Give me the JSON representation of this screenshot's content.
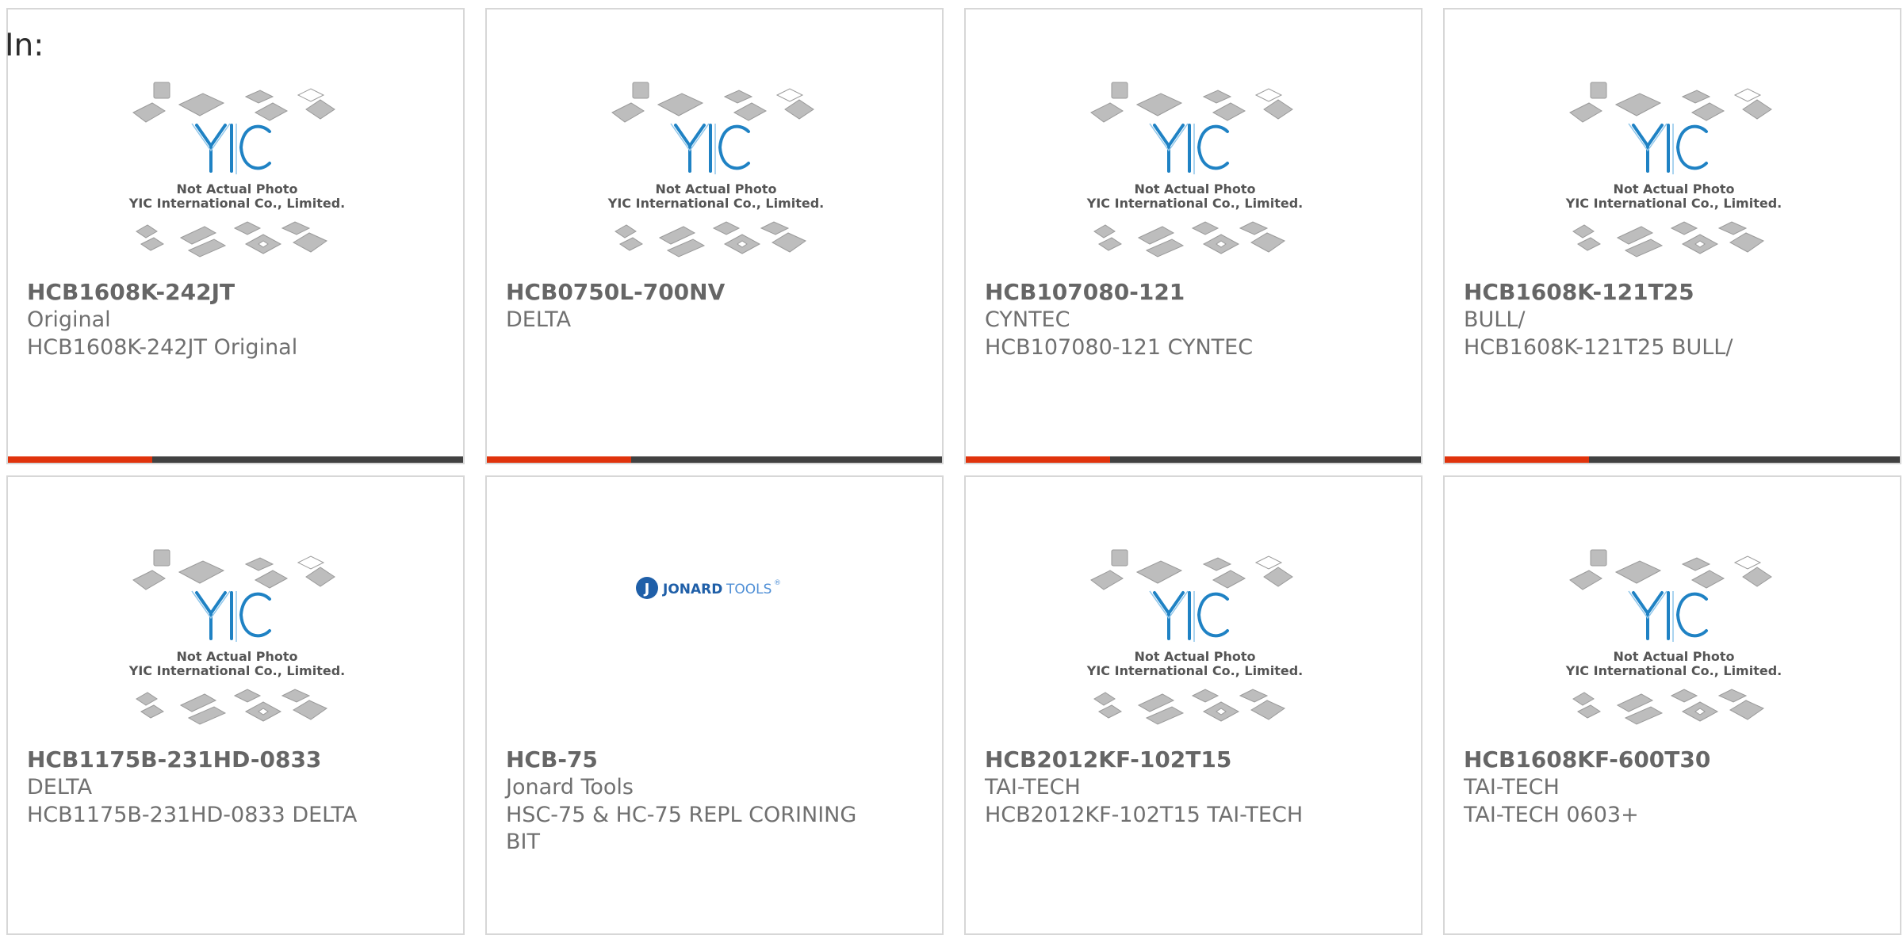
{
  "page_label": "In:",
  "colors": {
    "accent": "#e0330c",
    "bar_dark": "#414141",
    "logo_blue": "#1f82c4"
  },
  "placeholder": {
    "line1": "Not Actual Photo",
    "line2": "YIC International Co., Limited."
  },
  "jonard_logo": {
    "left": "JONARD",
    "right": "TOOLS",
    "mark": "J",
    "reg": "®"
  },
  "products": [
    {
      "part_number": "HCB1608K-242JT",
      "manufacturer": "Original",
      "description": "HCB1608K-242JT Original",
      "image": "yic-placeholder"
    },
    {
      "part_number": "HCB0750L-700NV",
      "manufacturer": "DELTA",
      "description": "",
      "image": "yic-placeholder"
    },
    {
      "part_number": "HCB107080-121",
      "manufacturer": "CYNTEC",
      "description": "HCB107080-121 CYNTEC",
      "image": "yic-placeholder"
    },
    {
      "part_number": "HCB1608K-121T25",
      "manufacturer": "BULL/",
      "description": "HCB1608K-121T25 BULL/",
      "image": "yic-placeholder"
    },
    {
      "part_number": "HCB1175B-231HD-0833",
      "manufacturer": "DELTA",
      "description": "HCB1175B-231HD-0833 DELTA",
      "image": "yic-placeholder"
    },
    {
      "part_number": "HCB-75",
      "manufacturer": "Jonard Tools",
      "description": "HSC-75 & HC-75 REPL CORINING BIT",
      "image": "jonard-logo"
    },
    {
      "part_number": "HCB2012KF-102T15",
      "manufacturer": "TAI-TECH",
      "description": "HCB2012KF-102T15 TAI-TECH",
      "image": "yic-placeholder"
    },
    {
      "part_number": "HCB1608KF-600T30",
      "manufacturer": "TAI-TECH",
      "description": "TAI-TECH 0603+",
      "image": "yic-placeholder"
    }
  ]
}
